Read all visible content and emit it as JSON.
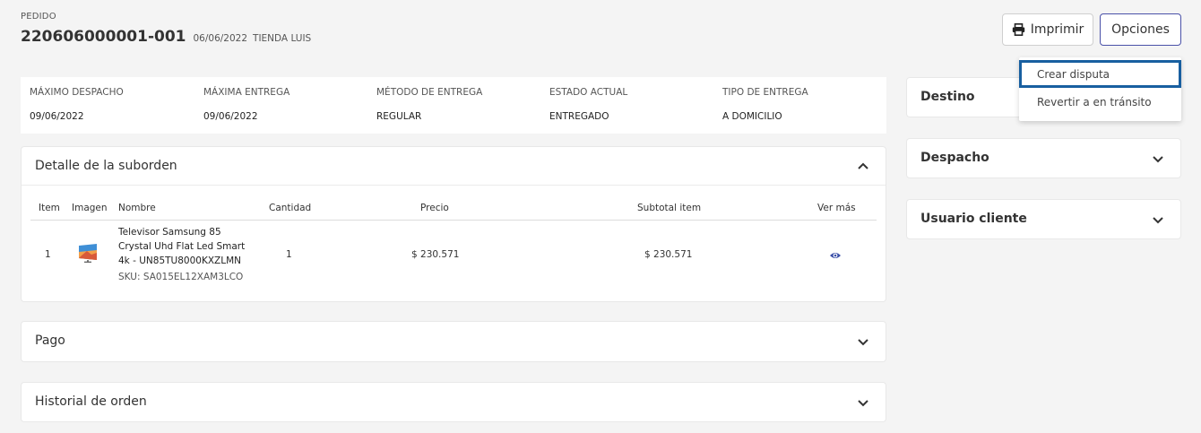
{
  "header": {
    "label": "PEDIDO",
    "order_id": "220606000001-001",
    "date": "06/06/2022",
    "store": "TIENDA LUIS"
  },
  "toolbar": {
    "print_label": "Imprimir",
    "options_label": "Opciones"
  },
  "options_menu": {
    "items": [
      "Crear disputa",
      "Revertir a en tránsito"
    ]
  },
  "summary": {
    "fields": [
      {
        "label": "MÁXIMO DESPACHO",
        "value": "09/06/2022"
      },
      {
        "label": "MÁXIMA ENTREGA",
        "value": "09/06/2022"
      },
      {
        "label": "MÉTODO DE ENTREGA",
        "value": "REGULAR"
      },
      {
        "label": "ESTADO ACTUAL",
        "value": "ENTREGADO"
      },
      {
        "label": "TIPO DE ENTREGA",
        "value": "A DOMICILIO"
      }
    ]
  },
  "suborder": {
    "title": "Detalle de la suborden",
    "columns": [
      "Item",
      "Imagen",
      "Nombre",
      "Cantidad",
      "Precio",
      "Subtotal item",
      "Ver más"
    ],
    "rows": [
      {
        "item": "1",
        "name_lines": [
          "Televisor Samsung 85",
          "Crystal Uhd Flat Led Smart",
          "4k - UN85TU8000KXZLMN"
        ],
        "sku": "SKU: SA015EL12XAM3LCO",
        "quantity": "1",
        "price": "$ 230.571",
        "subtotal": "$ 230.571"
      }
    ]
  },
  "sections": {
    "pago": "Pago",
    "historial": "Historial de orden",
    "destino": "Destino",
    "despacho": "Despacho",
    "usuario": "Usuario cliente"
  },
  "colors": {
    "accent": "#4a51a8",
    "focus": "#185fa0",
    "eye_icon": "#3a4fa8"
  },
  "icons": [
    "printer-icon",
    "chevron-up-icon",
    "chevron-down-icon",
    "eye-icon",
    "tv-thumbnail-image"
  ]
}
